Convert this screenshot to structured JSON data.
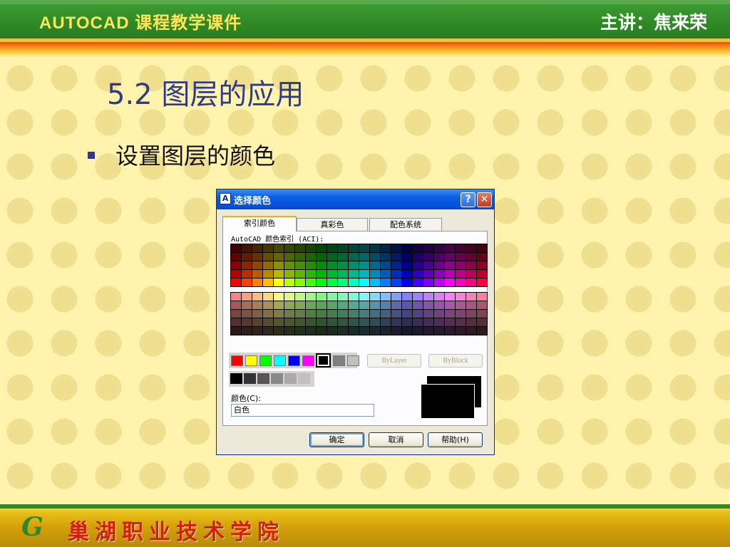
{
  "header": {
    "course_title": "AUTOCAD 课程教学课件",
    "lecturer": "主讲：焦来荣"
  },
  "slide": {
    "title": "5.2  图层的应用",
    "bullet": "设置图层的颜色"
  },
  "dialog": {
    "title": "选择颜色",
    "title_buttons": {
      "help": "?",
      "close": "✕"
    },
    "tabs": [
      {
        "label": "索引颜色",
        "active": true
      },
      {
        "label": "真彩色",
        "active": false
      },
      {
        "label": "配色系统",
        "active": false
      }
    ],
    "aci_label": "AutoCAD 颜色索引 (ACI):",
    "standard_colors": [
      "#ff0000",
      "#ffff00",
      "#00ff00",
      "#00ffff",
      "#0000ff",
      "#ff00ff",
      "#000000",
      "#808080",
      "#c0c0c0"
    ],
    "gray_colors": [
      "#000000",
      "#333333",
      "#555555",
      "#888888",
      "#aaaaaa",
      "#c0c0c0"
    ],
    "bylayer_label": "ByLayer",
    "byblock_label": "ByBlock",
    "color_label": "颜色(C):",
    "color_value": "白色",
    "buttons": {
      "ok": "确定",
      "cancel": "取消",
      "help": "帮助(H)"
    }
  },
  "footer": {
    "logo": "G",
    "school": "巢湖职业技术学院"
  },
  "colors": {
    "header_green": "#2f8a26",
    "title_blue": "#2e3a8c",
    "school_red": "#d91b0e",
    "dialog_title_blue": "#0454d8"
  }
}
